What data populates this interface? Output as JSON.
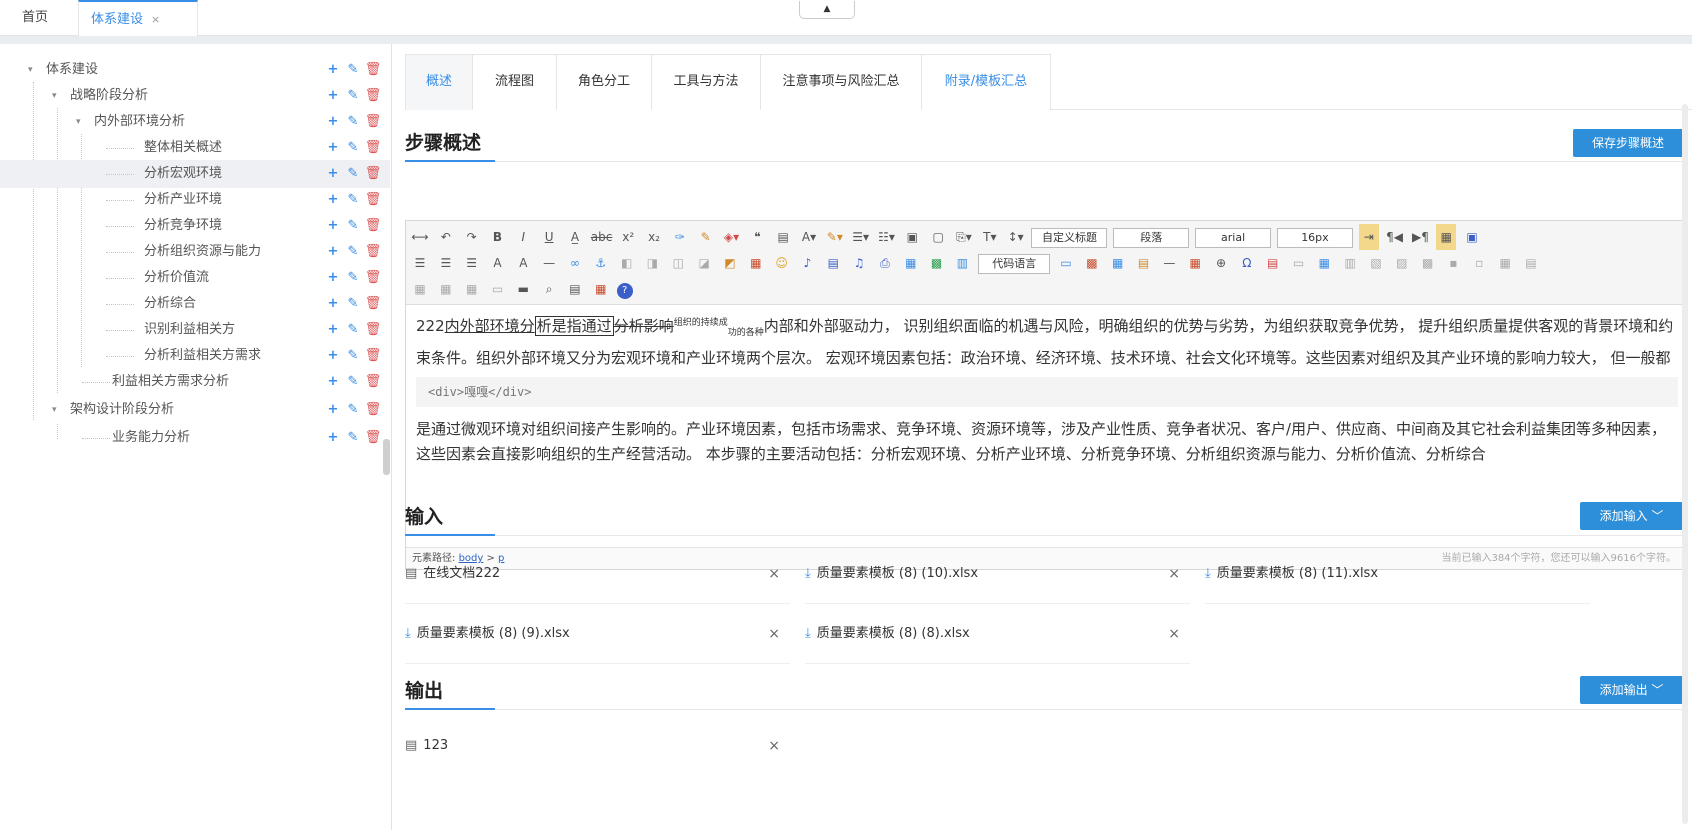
{
  "topbar": {
    "home": "首页",
    "active_tab": "体系建设",
    "close": "×",
    "collapse": "▲"
  },
  "tree": {
    "rows": [
      {
        "label": "体系建设",
        "caret": "▾"
      },
      {
        "label": "战略阶段分析",
        "caret": "▾"
      },
      {
        "label": "内外部环境分析",
        "caret": "▾"
      },
      {
        "label": "整体相关概述"
      },
      {
        "label": "分析宏观环境"
      },
      {
        "label": "分析产业环境"
      },
      {
        "label": "分析竞争环境"
      },
      {
        "label": "分析组织资源与能力"
      },
      {
        "label": "分析价值流"
      },
      {
        "label": "分析综合"
      },
      {
        "label": "识别利益相关方"
      },
      {
        "label": "分析利益相关方需求"
      },
      {
        "label": "利益相关方需求分析"
      },
      {
        "label": "架构设计阶段分析",
        "caret": "▾"
      },
      {
        "label": "业务能力分析"
      }
    ],
    "add": "+",
    "edit": "✎",
    "del": "🗑"
  },
  "tabs": [
    "概述",
    "流程图",
    "角色分工",
    "工具与方法",
    "注意事项与风险汇总",
    "附录/模板汇总"
  ],
  "overview": {
    "title": "步骤概述",
    "save_btn": "保存步骤概述"
  },
  "toolbar": {
    "row1": [
      "⟷",
      "↶",
      "↷",
      "B",
      "I",
      "U",
      "A̲",
      "abc",
      "x²",
      "x₂",
      "✑",
      "✎",
      "◈▾",
      "❝",
      "▤",
      "A▾",
      "✎▾",
      "☰▾",
      "☷▾",
      "▣",
      "▢",
      "⎘▾",
      "T▾",
      "↕▾"
    ],
    "selects": [
      "自定义标题",
      "段落",
      "arial",
      "16px"
    ],
    "row1_tail": [
      "⇥",
      "¶◀",
      "▶¶",
      "▦",
      "▣"
    ],
    "row2": [
      "☰",
      "☰",
      "☰",
      "A",
      "A",
      "—",
      "∞",
      "⚓",
      "◧",
      "◨",
      "◫",
      "◪",
      "◩",
      "▦",
      "☺",
      "♪",
      "▤",
      "♫",
      "⎙",
      "▦",
      "▩",
      "▥"
    ],
    "code_lang": "代码语言",
    "row2_tail": [
      "▭",
      "▩",
      "▦",
      "▤",
      "—",
      "▦",
      "⊕",
      "Ω",
      "▤",
      "▭",
      "▦",
      "▥",
      "▧",
      "▨",
      "▩",
      "▪",
      "▫",
      "▦",
      "▤"
    ],
    "row3": [
      "▦",
      "▦",
      "▦",
      "▭",
      "▬",
      "⌕",
      "▤",
      "▦",
      "?"
    ]
  },
  "content": {
    "p1_start": "222",
    "p1_u1": "内外部环境分",
    "p1_box": "析是指通过",
    "p1_strike": "分析影响",
    "p1_sup": "组织的持续成",
    "p1_sub": "功的各种",
    "p1_rest": "内部和外部驱动力， 识别组织面临的机遇与风险，明确组织的优势与劣势，为组织获取竞争优势， 提升组织质量提供客观的背景环境和约束条件。组织外部环境又分为宏观环境和产业环境两个层次。 宏观环境因素包括：政治环境、经济环境、技术环境、社会文化环境等。这些因素对组织及其产业环境的影响力较大， 但一般都",
    "code": "<div>嘎嘎</div>",
    "p2": "是通过微观环境对组织间接产生影响的。产业环境因素，包括市场需求、竞争环境、资源环境等，涉及产业性质、竞争者状况、客户/用户、供应商、中间商及其它社会利益集团等多种因素，这些因素会直接影响组织的生产经营活动。 本步骤的主要活动包括：分析宏观环境、分析产业环境、分析竞争环境、分析组织资源与能力、分析价值流、分析综合"
  },
  "status": {
    "path_label": "元素路径:",
    "path_body": "body",
    "path_sep": " > ",
    "path_p": "p",
    "count": "当前已输入384个字符，您还可以输入9616个字符。"
  },
  "inputs": {
    "title": "输入",
    "add_btn": "添加输入 ﹀",
    "files": [
      {
        "icon": "doc",
        "name": "在线文档222"
      },
      {
        "icon": "download",
        "name": "质量要素模板 (8) (10).xlsx"
      },
      {
        "icon": "download",
        "name": "质量要素模板 (8) (11).xlsx"
      },
      {
        "icon": "download",
        "name": "质量要素模板 (8) (9).xlsx"
      },
      {
        "icon": "download",
        "name": "质量要素模板 (8) (8).xlsx"
      }
    ]
  },
  "outputs": {
    "title": "输出",
    "add_btn": "添加输出 ﹀",
    "files": [
      {
        "icon": "doc",
        "name": "123"
      }
    ]
  },
  "icons": {
    "doc": "▤",
    "download": "⤓",
    "close": "×"
  },
  "colors": {
    "accent": "#3a8ee6",
    "button": "#2d8fd9",
    "delete": "#e05555"
  }
}
